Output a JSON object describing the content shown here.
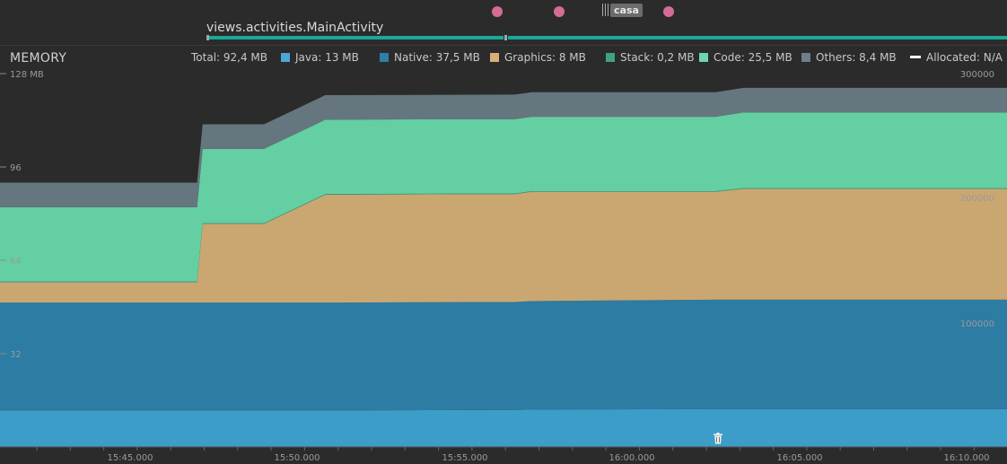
{
  "events": {
    "activity_name": "views.activities.MainActivity",
    "tag_label": "casa"
  },
  "memory": {
    "title": "MEMORY",
    "legend": [
      {
        "label": "Total: 92,4 MB",
        "color": ""
      },
      {
        "label": "Java: 13 MB",
        "color": "#4aa8d8"
      },
      {
        "label": "Native: 37,5 MB",
        "color": "#2f7ea5"
      },
      {
        "label": "Graphics: 8 MB",
        "color": "#d9ae78"
      },
      {
        "label": "Stack: 0,2 MB",
        "color": "#3fa37f"
      },
      {
        "label": "Code: 25,5 MB",
        "color": "#6dd6ac"
      },
      {
        "label": "Others: 8,4 MB",
        "color": "#6e7f88"
      },
      {
        "label": "Allocated: N/A",
        "color": "#ffffff"
      }
    ]
  },
  "axis": {
    "left_ticks": [
      "128 MB",
      "96",
      "64",
      "32"
    ],
    "right_ticks": [
      "300000",
      "200000",
      "100000"
    ],
    "time_ticks": [
      "15:45.000",
      "15:50.000",
      "15:55.000",
      "16:00.000",
      "16:05.000",
      "16:10.000"
    ]
  },
  "chart_data": {
    "type": "area",
    "x": [
      "15:41:50",
      "15:47:00",
      "15:47:10",
      "15:48:30",
      "15:49:00",
      "15:50:50",
      "15:56:30",
      "15:57:00",
      "16:02:30",
      "16:03:20",
      "16:11:50"
    ],
    "ylim": [
      0,
      128
    ],
    "y2lim": [
      0,
      300000
    ],
    "series": [
      {
        "name": "Java",
        "color": "#3d9dc9",
        "values": [
          12.5,
          12.5,
          12.5,
          12.5,
          12.5,
          12.5,
          12.7,
          12.8,
          13.0,
          13.0,
          13.0
        ]
      },
      {
        "name": "Native",
        "color": "#2d7ca3",
        "values": [
          37.0,
          37.0,
          37.0,
          37.0,
          37.0,
          37.0,
          37.0,
          37.2,
          37.5,
          37.5,
          37.5
        ]
      },
      {
        "name": "Graphics",
        "color": "#caa771",
        "values": [
          7.0,
          7.0,
          27.0,
          27.0,
          27.0,
          37.0,
          37.0,
          37.5,
          37.0,
          38.0,
          38.0
        ]
      },
      {
        "name": "Stack",
        "color": "#3fa37f",
        "values": [
          0.2,
          0.2,
          0.2,
          0.2,
          0.2,
          0.2,
          0.2,
          0.2,
          0.2,
          0.2,
          0.2
        ]
      },
      {
        "name": "Code",
        "color": "#64cfa2",
        "values": [
          25.5,
          25.5,
          25.5,
          25.5,
          25.5,
          25.5,
          25.5,
          25.5,
          25.5,
          26.0,
          26.0
        ]
      },
      {
        "name": "Others",
        "color": "#65767e",
        "values": [
          8.4,
          8.4,
          8.4,
          8.4,
          8.4,
          8.4,
          8.4,
          8.4,
          8.4,
          8.4,
          8.4
        ]
      }
    ]
  }
}
